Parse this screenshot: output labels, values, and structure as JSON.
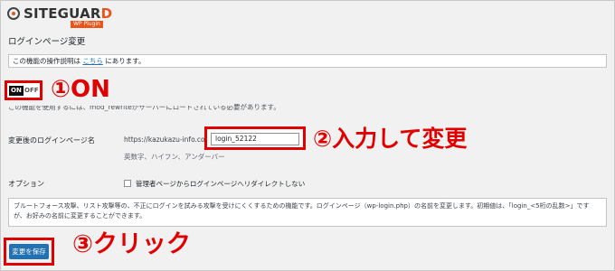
{
  "logo": {
    "text_prefix": "SITEGUAR",
    "text_accent": "D",
    "subtitle": "WP Plugin"
  },
  "page": {
    "title": "ログインページ変更"
  },
  "notice": {
    "prefix": "この機能の操作説明は ",
    "link": "こちら",
    "suffix": " にあります。"
  },
  "toggle": {
    "on_label": "ON",
    "off_label": "OFF",
    "state": "on"
  },
  "annotations": {
    "step1": "①ON",
    "step2": "②入力して変更",
    "step3": "③クリック"
  },
  "mod_notice": "この機能を使用するには、mod_rewriteがサーバーにロードされている必要があります。",
  "login_page": {
    "label": "変更後のログインページ名",
    "url_prefix": "https://kazukazu-info.com/",
    "value": "login_52122",
    "hint": "英数字、ハイフン、アンダーバー"
  },
  "options": {
    "label": "オプション",
    "redirect_label": "管理者ページからログインページへリダイレクトしない",
    "redirect_checked": false
  },
  "description": "ブルートフォース攻撃、リスト攻撃等の、不正にログインを試みる攻撃を受けにくくするための機能です。ログインページ（wp-login.php）の名前を変更します。初期値は、「login_<5桁の乱数>」ですが、お好みの名前に変更することができます。",
  "save_button": {
    "label": "変更を保存"
  },
  "colors": {
    "accent_red": "#e00000",
    "button_blue": "#2271b1",
    "brand_orange": "#e8541a"
  }
}
